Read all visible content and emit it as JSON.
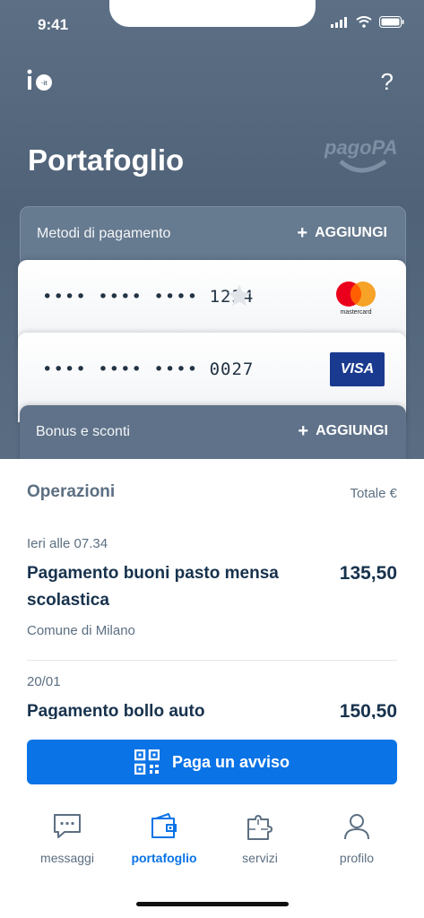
{
  "status_bar": {
    "time": "9:41"
  },
  "header": {
    "title": "Portafoglio",
    "help": "?",
    "brand": "pagoPA"
  },
  "payment_methods": {
    "label": "Metodi di pagamento",
    "add_label": "AGGIUNGI",
    "cards": [
      {
        "number": "•••• •••• •••• 1234",
        "brand": "mastercard",
        "favorite": true
      },
      {
        "number": "•••• •••• •••• 0027",
        "brand": "VISA"
      }
    ]
  },
  "bonus": {
    "label": "Bonus e sconti",
    "add_label": "AGGIUNGI"
  },
  "operations": {
    "title": "Operazioni",
    "total_label": "Totale €",
    "items": [
      {
        "date": "Ieri alle 07.34",
        "name": "Pagamento buoni pasto mensa scolastica",
        "amount": "135,50",
        "org": "Comune di Milano"
      },
      {
        "date": "20/01",
        "name": "Pagamento bollo auto",
        "amount": "150,50"
      }
    ]
  },
  "pay_button": {
    "label": "Paga un avviso"
  },
  "tabs": [
    {
      "label": "messaggi",
      "icon": "chat-icon"
    },
    {
      "label": "portafoglio",
      "icon": "wallet-icon",
      "active": true
    },
    {
      "label": "servizi",
      "icon": "puzzle-icon"
    },
    {
      "label": "profilo",
      "icon": "user-icon"
    }
  ],
  "colors": {
    "primary": "#0a73e6",
    "header": "#5c6f85",
    "text_dark": "#17324d"
  }
}
